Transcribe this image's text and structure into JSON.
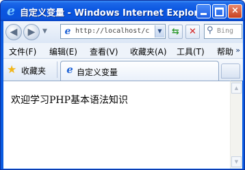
{
  "window": {
    "title": "自定义变量 - Windows Internet Explorer",
    "app_icon": "ie-logo-icon"
  },
  "titlebar_buttons": {
    "minimize": "minimize-icon",
    "maximize": "maximize-icon",
    "close": "×"
  },
  "nav": {
    "back": "◀",
    "forward": "▶",
    "history": "▼",
    "address": "http://localhost/c",
    "address_dropdown": "▼",
    "refresh": "⇆",
    "stop": "✕",
    "search_placeholder": "Bing",
    "search_icon": "⚲"
  },
  "menu": {
    "items": [
      "文件(F)",
      "编辑(E)",
      "查看(V)",
      "收藏夹(A)",
      "工具(T)",
      "帮助"
    ],
    "overflow": "»"
  },
  "favorites": {
    "label": "收藏夹",
    "star": "★"
  },
  "tab": {
    "title": "自定义变量"
  },
  "page": {
    "text": "欢迎学习PHP基本语法知识"
  },
  "scrollbar": {
    "up": "▲",
    "down": "▼"
  },
  "colors": {
    "titlebar": "#0955e0",
    "close_button": "#c8401f",
    "refresh": "#2e9a2e",
    "stop": "#d32020",
    "favorites_star": "#f2b619"
  }
}
